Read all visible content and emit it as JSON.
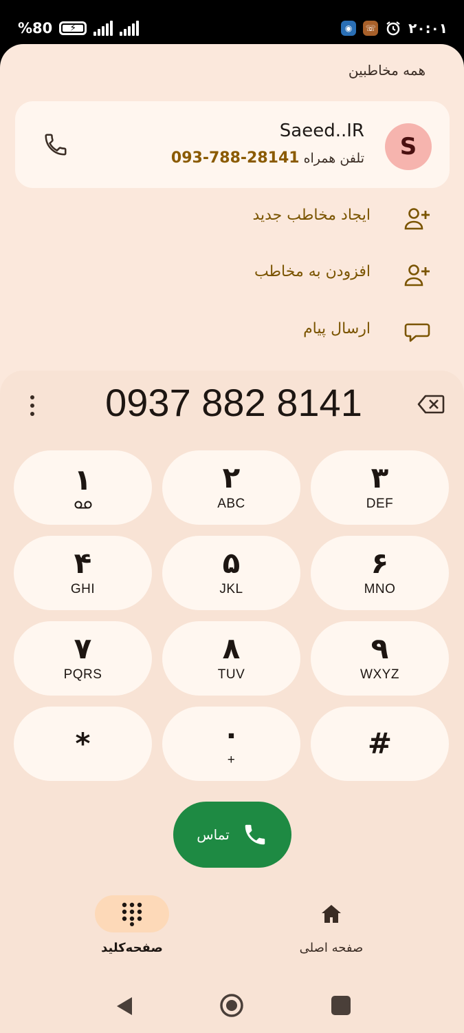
{
  "status_bar": {
    "battery_text": "%80",
    "time": "۲۰:۰۱"
  },
  "header": {
    "all_contacts": "همه مخاطبین"
  },
  "contact": {
    "initial": "S",
    "name": "Saeed..IR",
    "phone_label": "تلفن همراه",
    "phone_number": "093-788-28141"
  },
  "actions": [
    {
      "label": "ایجاد مخاطب جدید",
      "icon": "person-add-icon"
    },
    {
      "label": "افزودن به مخاطب",
      "icon": "person-add-icon"
    },
    {
      "label": "ارسال پیام",
      "icon": "message-icon"
    }
  ],
  "dialer": {
    "number": "0937 882 8141",
    "keys": [
      {
        "digit": "۱",
        "letters": ""
      },
      {
        "digit": "۲",
        "letters": "ABC"
      },
      {
        "digit": "۳",
        "letters": "DEF"
      },
      {
        "digit": "۴",
        "letters": "GHI"
      },
      {
        "digit": "۵",
        "letters": "JKL"
      },
      {
        "digit": "۶",
        "letters": "MNO"
      },
      {
        "digit": "۷",
        "letters": "PQRS"
      },
      {
        "digit": "۸",
        "letters": "TUV"
      },
      {
        "digit": "۹",
        "letters": "WXYZ"
      },
      {
        "digit": "*",
        "letters": ""
      },
      {
        "digit": "۰",
        "letters": "+"
      },
      {
        "digit": "#",
        "letters": ""
      }
    ],
    "call_label": "تماس"
  },
  "bottom_nav": {
    "keypad_label": "صفحه‌کلید",
    "home_label": "صفحه اصلی"
  },
  "colors": {
    "sheet_bg": "#fbe8dc",
    "accent_text": "#7a5400",
    "call_green": "#1e8a43",
    "avatar_bg": "#f6b4ae"
  }
}
